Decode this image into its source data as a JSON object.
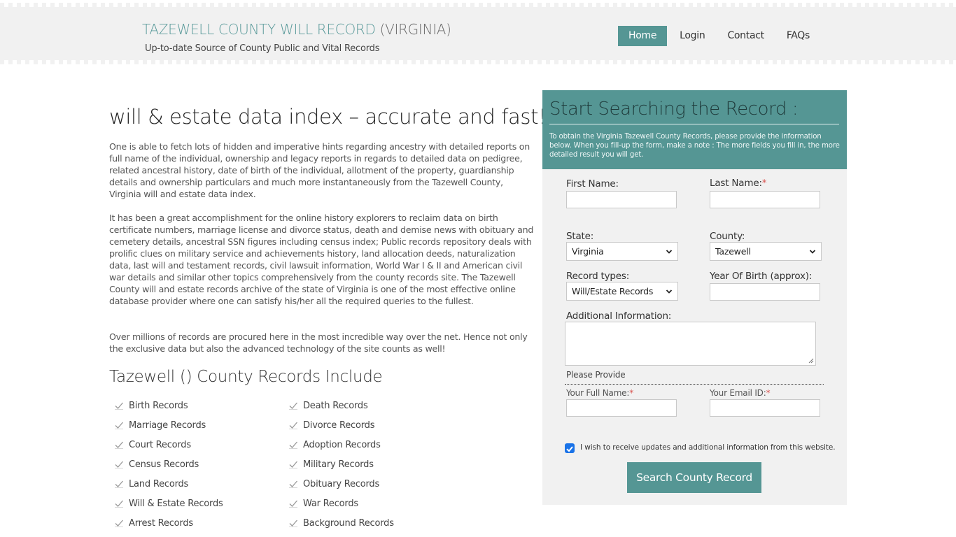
{
  "header": {
    "title_main": "TAZEWELL COUNTY WILL RECORD",
    "title_suffix": " (VIRGINIA)",
    "tagline": "Up-to-date Source of  County Public and Vital Records",
    "nav": [
      {
        "label": "Home",
        "active": true
      },
      {
        "label": "Login",
        "active": false
      },
      {
        "label": "Contact",
        "active": false
      },
      {
        "label": "FAQs",
        "active": false
      }
    ]
  },
  "main": {
    "title": "will & estate data index – accurate and fast!",
    "paragraphs": [
      "One is able to fetch lots of hidden and imperative hints regarding ancestry with detailed reports on full name of the individual, ownership and legacy reports in regards to detailed data on pedigree, related ancestral history, date of birth of the individual, allotment of the property, guardianship details and ownership particulars and much more instantaneously from the Tazewell County, Virginia will and estate data index.",
      "It has been a great accomplishment for the online history explorers to reclaim data on birth certificate numbers, marriage license and divorce status, death and demise news with obituary and cemetery details, ancestral SSN figures including census index; Public records repository deals with prolific clues on military service and achievements history, land allocation deeds, naturalization data, last will and testament records, civil lawsuit information, World War I & II and American civil war details and similar other topics comprehensively from the county records site. The Tazewell County will and estate records archive of the state of Virginia is one of the most effective online database provider where one can satisfy his/her all the required queries to the fullest.",
      "Over millions of records are procured here in the most incredible way over the net. Hence not only the exclusive data but also the advanced technology of the site counts as well!"
    ],
    "records_title": "Tazewell () County Records Include",
    "records": [
      "Birth Records",
      "Death Records",
      "Marriage Records",
      "Divorce Records",
      "Court Records",
      "Adoption Records",
      "Census Records",
      "Military Records",
      "Land Records",
      "Obituary Records",
      "Will & Estate Records",
      "War Records",
      "Arrest Records",
      "Background Records"
    ]
  },
  "form": {
    "title": "Start Searching the Record :",
    "description": "To obtain the Virginia Tazewell County Records, please provide the information below. When you fill-up the form, make a note : The more fields you fill in, the more detailed result you will get.",
    "first_name_label": "First Name:",
    "first_name_value": "",
    "last_name_label": "Last Name:",
    "last_name_value": "",
    "required_mark": "*",
    "state_label": "State:",
    "state_value": "Virginia",
    "county_label": "County:",
    "county_value": "Tazewell",
    "record_types_label": "Record types:",
    "record_types_value": "Will/Estate Records",
    "yob_label": "Year Of Birth (approx):",
    "yob_value": "",
    "additional_label": "Additional Information:",
    "additional_value": "",
    "please_provide": "Please Provide",
    "full_name_label": "Your Full Name:",
    "full_name_value": "",
    "email_label": "Your Email ID:",
    "email_value": "",
    "updates_checked": true,
    "updates_label": "I wish to receive updates and additional information from this website.",
    "submit_label": "Search County Record"
  },
  "colors": {
    "accent": "#559694",
    "title_accent": "#5a9a9a",
    "header_bg": "#f1f1f1",
    "required": "#d9534f",
    "checkbox": "#1a73e8"
  }
}
